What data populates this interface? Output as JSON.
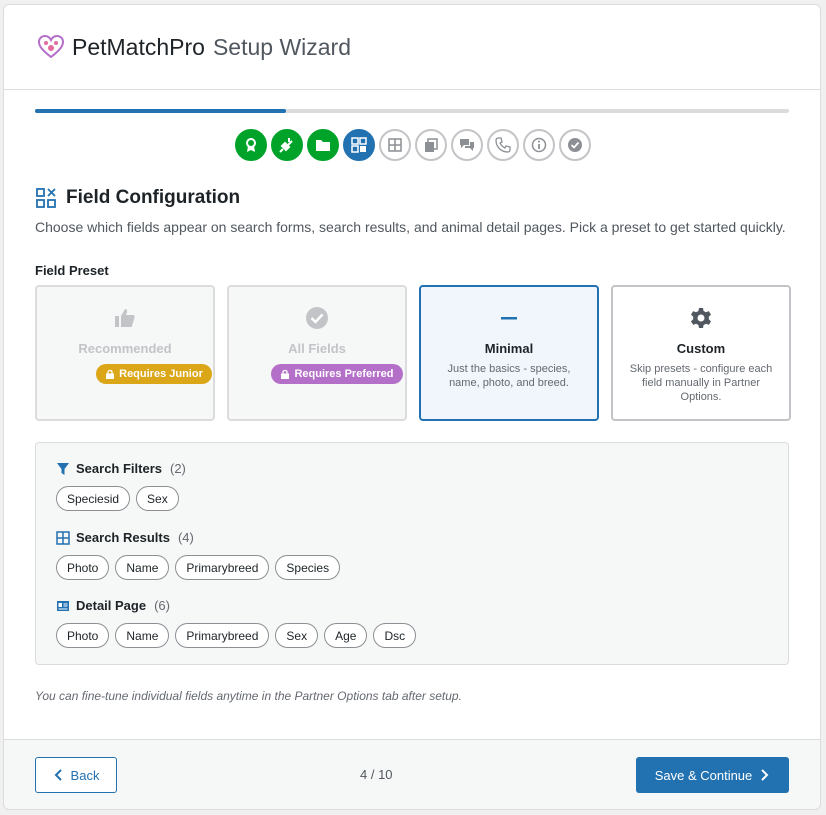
{
  "header": {
    "brand": "PetMatchPro",
    "subtitle": "Setup Wizard"
  },
  "progress": {
    "fraction": 0.333
  },
  "steps": [
    {
      "icon": "award-icon",
      "state": "done"
    },
    {
      "icon": "plug-icon",
      "state": "done"
    },
    {
      "icon": "folder-icon",
      "state": "done"
    },
    {
      "icon": "grid-icon",
      "state": "current"
    },
    {
      "icon": "layout-icon",
      "state": "pending"
    },
    {
      "icon": "copy-icon",
      "state": "pending"
    },
    {
      "icon": "chat-icon",
      "state": "pending"
    },
    {
      "icon": "phone-icon",
      "state": "pending"
    },
    {
      "icon": "info-icon",
      "state": "pending"
    },
    {
      "icon": "check-icon",
      "state": "pending"
    }
  ],
  "section": {
    "title": "Field Configuration",
    "description": "Choose which fields appear on search forms, search results, and animal detail pages. Pick a preset to get started quickly."
  },
  "preset_label": "Field Preset",
  "presets": [
    {
      "title": "Recommended",
      "badge": "Requires Junior",
      "icon": "thumbs-up-icon"
    },
    {
      "title": "All Fields",
      "badge": "Requires Preferred",
      "icon": "check-circle-icon"
    },
    {
      "title": "Minimal",
      "desc": "Just the basics - species, name, photo, and breed.",
      "icon": "minus-icon"
    },
    {
      "title": "Custom",
      "desc": "Skip presets - configure each field manually in Partner Options.",
      "icon": "gear-icon"
    }
  ],
  "groups": [
    {
      "title": "Search Filters",
      "count": "(2)",
      "icon": "filter-icon",
      "chips": [
        "Speciesid",
        "Sex"
      ]
    },
    {
      "title": "Search Results",
      "count": "(4)",
      "icon": "table-icon",
      "chips": [
        "Photo",
        "Name",
        "Primarybreed",
        "Species"
      ]
    },
    {
      "title": "Detail Page",
      "count": "(6)",
      "icon": "id-card-icon",
      "chips": [
        "Photo",
        "Name",
        "Primarybreed",
        "Sex",
        "Age",
        "Dsc"
      ]
    }
  ],
  "note": "You can fine-tune individual fields anytime in the Partner Options tab after setup.",
  "footer": {
    "back": "Back",
    "page": "4 / 10",
    "next": "Save & Continue"
  }
}
